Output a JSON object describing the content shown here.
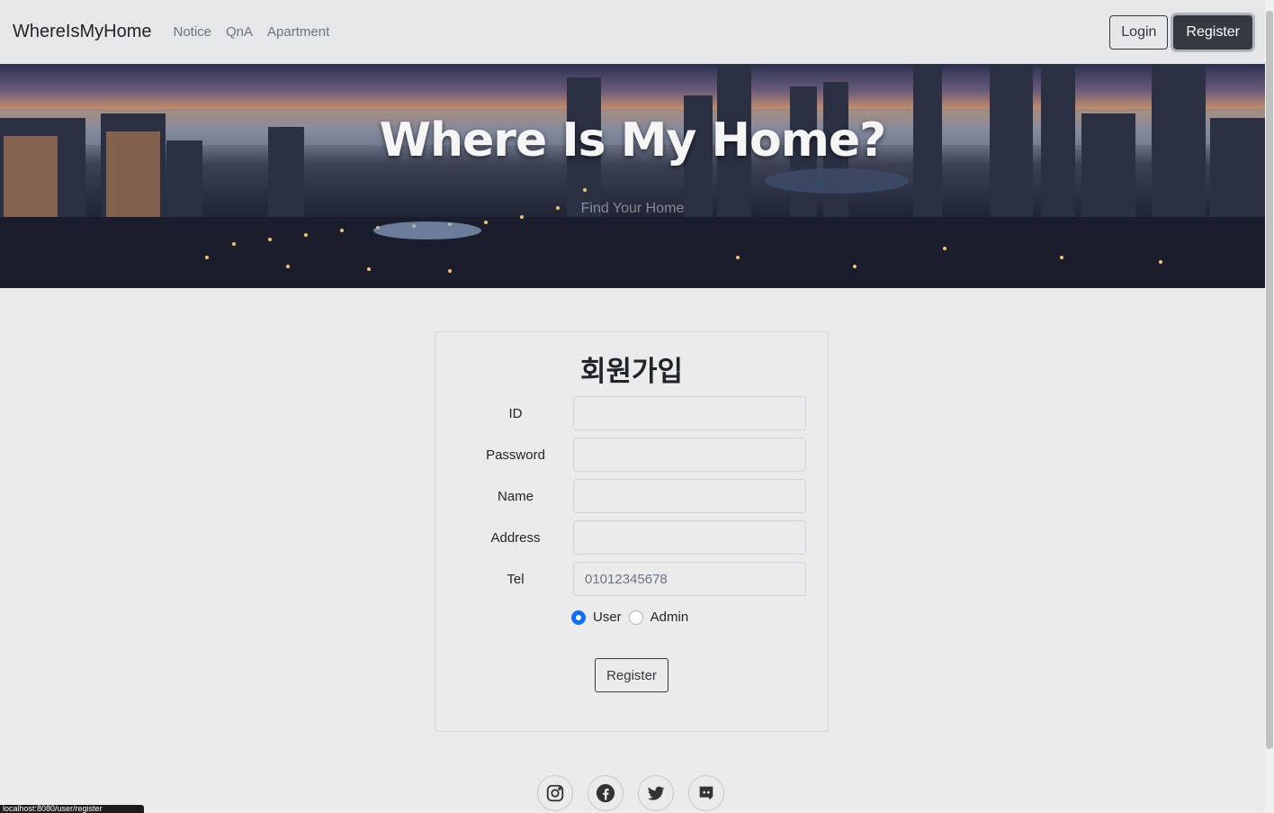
{
  "navbar": {
    "brand": "WhereIsMyHome",
    "links": [
      "Notice",
      "QnA",
      "Apartment"
    ],
    "login_label": "Login",
    "register_label": "Register"
  },
  "hero": {
    "title": "Where Is My Home?",
    "subtitle": "Find Your Home"
  },
  "form": {
    "title": "회원가입",
    "fields": [
      {
        "label": "ID",
        "value": "",
        "placeholder": ""
      },
      {
        "label": "Password",
        "value": "",
        "placeholder": ""
      },
      {
        "label": "Name",
        "value": "",
        "placeholder": ""
      },
      {
        "label": "Address",
        "value": "",
        "placeholder": ""
      },
      {
        "label": "Tel",
        "value": "",
        "placeholder": "01012345678"
      }
    ],
    "role_options": [
      "User",
      "Admin"
    ],
    "selected_role": "User",
    "submit_label": "Register"
  },
  "footer": {
    "social_icons": [
      "instagram-icon",
      "facebook-icon",
      "twitter-icon",
      "discord-icon"
    ]
  },
  "status_bar": {
    "url": "localhost:8080/user/register"
  },
  "colors": {
    "accent": "#0d6efd",
    "navbar_bg": "#e6e7e9",
    "page_bg": "#ebebeb",
    "dark_button": "#343a40"
  }
}
